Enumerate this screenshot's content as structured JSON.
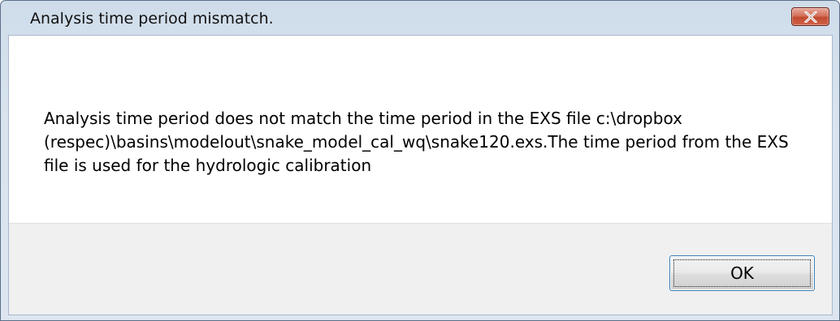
{
  "window": {
    "title": "Analysis time period mismatch."
  },
  "titlebar": {
    "close_icon": "close-x-icon",
    "close_color": "#c7503a"
  },
  "dialog": {
    "message": "Analysis time period does not match the time period in the EXS file c:\\dropbox (respec)\\basins\\modelout\\snake_model_cal_wq\\snake120.exs.The time period from the EXS file is used for the hydrologic calibration"
  },
  "buttons": {
    "ok_label": "OK"
  }
}
